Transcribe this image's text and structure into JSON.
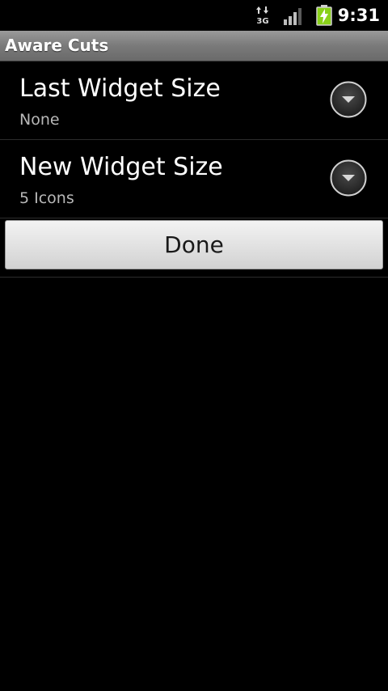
{
  "status_bar": {
    "network_icon": "3g-data-icon",
    "network_label": "3G",
    "signal_icon": "signal-strength-icon",
    "battery_icon": "battery-charging-icon",
    "time": "9:31"
  },
  "title_bar": {
    "title": "Aware Cuts"
  },
  "preferences": [
    {
      "title": "Last Widget Size",
      "summary": "None",
      "icon": "chevron-down-icon"
    },
    {
      "title": "New Widget Size",
      "summary": "5 Icons",
      "icon": "chevron-down-icon"
    }
  ],
  "done_label": "Done",
  "colors": {
    "background": "#000000",
    "title_bar": "#7a7a7a",
    "battery_green": "#8ad11a",
    "summary_text": "#b8b8b8"
  }
}
